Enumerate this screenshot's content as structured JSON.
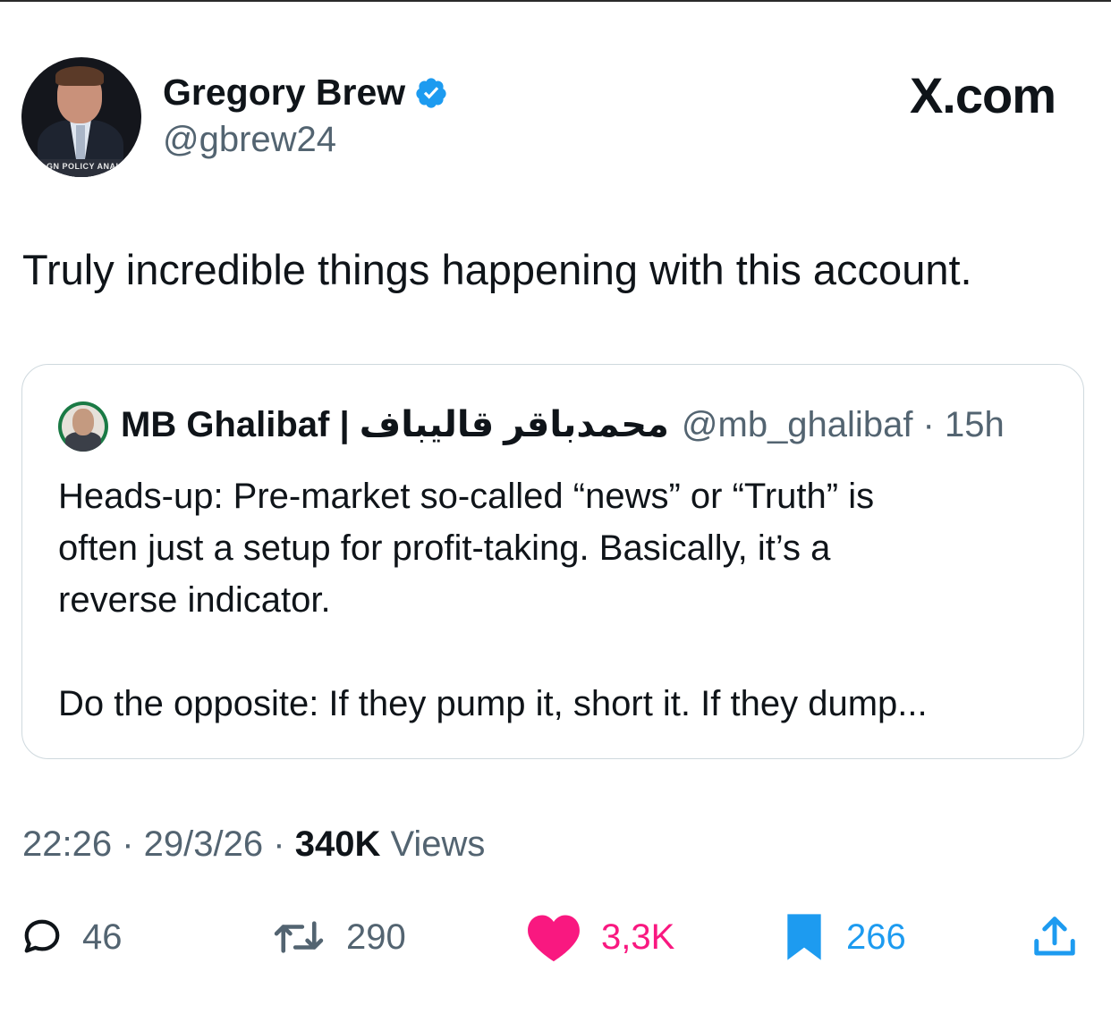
{
  "author": {
    "display_name": "Gregory Brew",
    "handle": "@gbrew24",
    "avatar_banner": "GN POLICY ANAL"
  },
  "brand": "X.com",
  "tweet": {
    "text": "Truly incredible things happening with this account."
  },
  "quote": {
    "name": "MB Ghalibaf | محمدباقر قالیباف",
    "handle": "@mb_ghalibaf",
    "time": "15h",
    "meta": "@mb_ghalibaf · 15h",
    "lines": [
      "Heads-up: Pre-market so-called “news” or “Truth” is",
      "often just a setup for profit-taking. Basically, it’s a",
      "reverse indicator."
    ],
    "line_last": "Do the opposite: If they pump it, short it. If they dump..."
  },
  "meta": {
    "time": "22:26",
    "date": "29/3/26",
    "views_count": "340K",
    "views_label": "Views"
  },
  "actions": {
    "replies": "46",
    "reposts": "290",
    "likes": "3,3K",
    "bookmarks": "266"
  },
  "colors": {
    "text": "#0f1419",
    "secondary": "#536471",
    "verified": "#1d9bf0",
    "like": "#f91880",
    "border": "#cfd9de"
  }
}
